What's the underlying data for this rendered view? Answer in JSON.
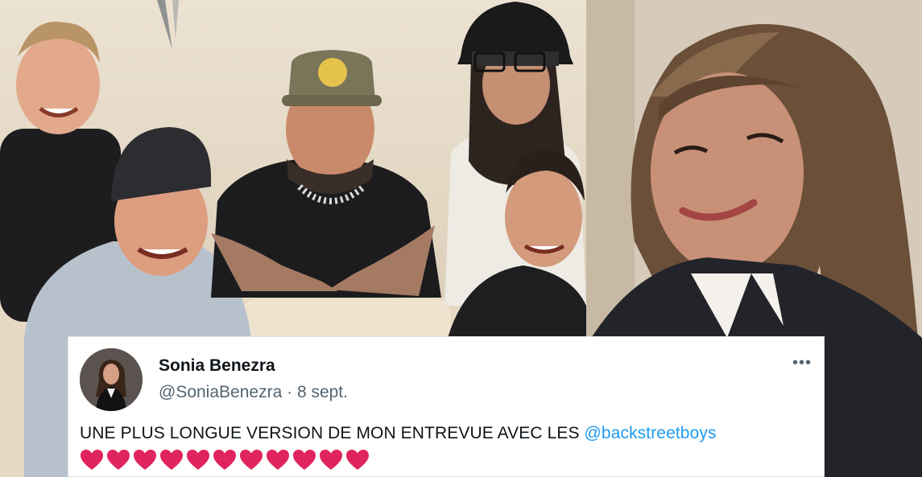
{
  "tweet": {
    "author_name": "Sonia Benezra",
    "handle": "@SoniaBenezra",
    "separator": "·",
    "date": "8 sept.",
    "more_label": "•••",
    "text_before_mention": "UNE PLUS LONGUE VERSION DE MON ENTREVUE AVEC LES ",
    "mention": "@backstreetboys",
    "emoji_name": "red-heart-icon",
    "emoji_count": 11
  },
  "colors": {
    "mention": "#1d9bf0",
    "heart": "#e0245e",
    "secondary_text": "#536471",
    "primary_text": "#0f1419"
  }
}
